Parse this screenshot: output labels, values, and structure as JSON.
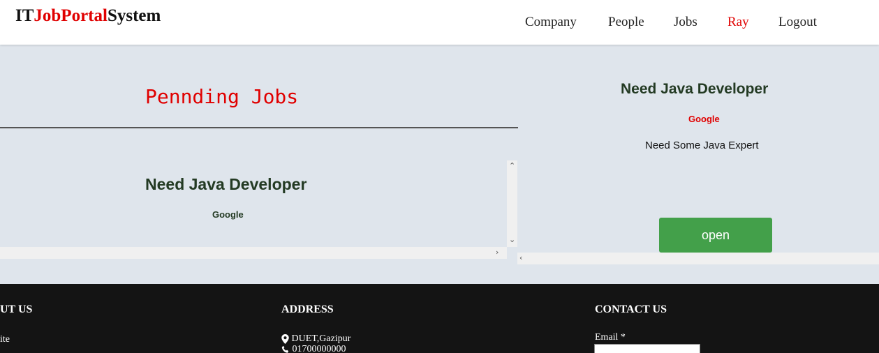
{
  "header": {
    "brand": {
      "part1": "IT",
      "part2": "JobPortal",
      "part3": "System"
    },
    "nav": [
      "Company",
      "People",
      "Jobs",
      "Ray",
      "Logout"
    ]
  },
  "pending": {
    "title": "Pennding Jobs",
    "jobs": [
      {
        "title": "Need Java Developer",
        "company": "Google"
      }
    ]
  },
  "detail": {
    "title": "Need Java Developer",
    "company": "Google",
    "description": "Need Some Java Expert",
    "open_label": "open"
  },
  "footer": {
    "about": {
      "heading": "UT US",
      "text": "ite"
    },
    "address": {
      "heading": "ADDRESS",
      "location": "DUET,Gazipur",
      "phone": "01700000000"
    },
    "contact": {
      "heading": "CONTACT US",
      "email_label": "Email *"
    }
  },
  "colors": {
    "accent_red": "#e00000",
    "open_green": "#43a04a",
    "footer_bg": "#141414",
    "page_bg": "#dfe5ec"
  },
  "icons": {
    "location": "map-marker-icon",
    "phone": "phone-icon"
  }
}
